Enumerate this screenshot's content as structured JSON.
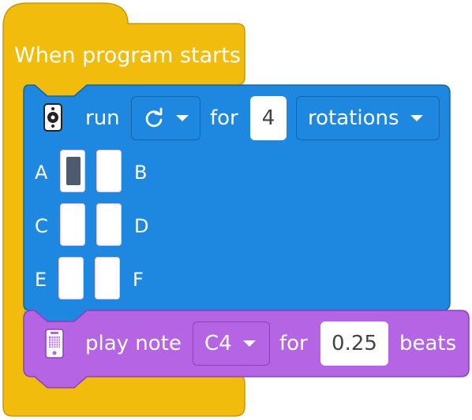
{
  "hat_block": {
    "label": "When program starts",
    "color": "#f2bc0c"
  },
  "motor_block": {
    "color": "#1e88e0",
    "icon": "motor-icon",
    "run_label": "run",
    "direction_icon": "rotate-clockwise-icon",
    "for_label": "for",
    "amount": "4",
    "unit": "rotations",
    "ports": [
      {
        "label": "A",
        "selected": true
      },
      {
        "label": "B",
        "selected": false
      },
      {
        "label": "C",
        "selected": false
      },
      {
        "label": "D",
        "selected": false
      },
      {
        "label": "E",
        "selected": false
      },
      {
        "label": "F",
        "selected": false
      }
    ]
  },
  "sound_block": {
    "color": "#b565e4",
    "icon": "light-matrix-icon",
    "play_label": "play note",
    "note": "C4",
    "for_label": "for",
    "beats_value": "0.25",
    "beats_label": "beats"
  }
}
